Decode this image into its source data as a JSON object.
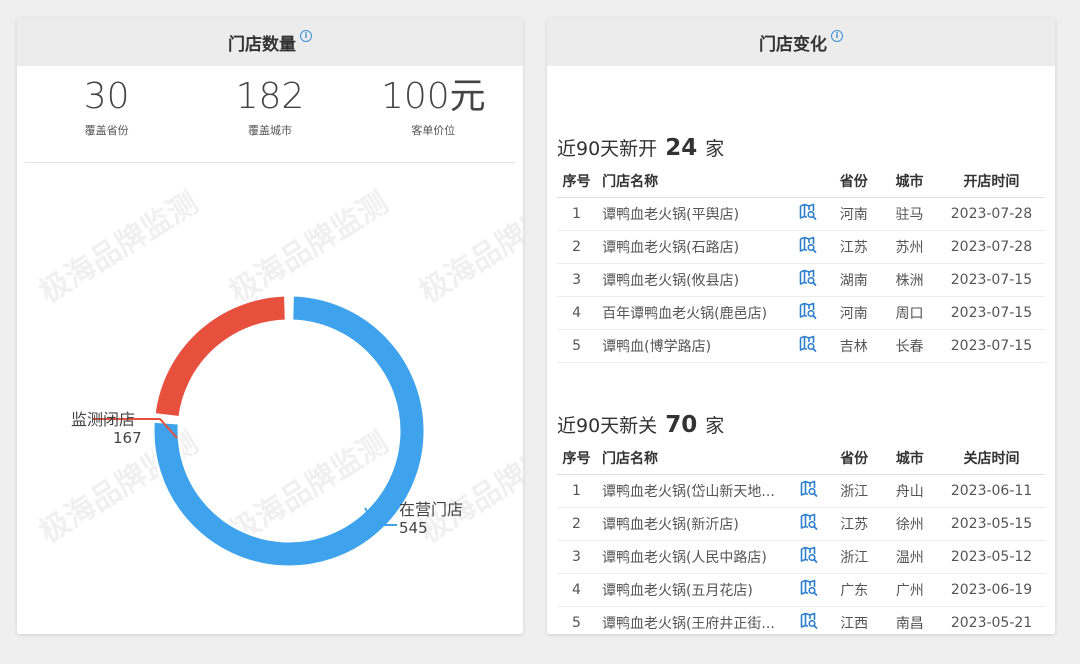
{
  "left_card": {
    "title": "门店数量",
    "info_glyph": "i",
    "stats": [
      {
        "value": "30",
        "label": "覆盖省份"
      },
      {
        "value": "182",
        "label": "覆盖城市"
      },
      {
        "value": "100元",
        "label": "客单价位"
      }
    ],
    "watermark": "极海品牌监测"
  },
  "chart_data": {
    "type": "pie",
    "variant": "donut",
    "slices": [
      {
        "label": "在营门店",
        "value": 545,
        "color": "#3ea3ec"
      },
      {
        "label": "监测闭店",
        "value": 167,
        "color": "#e8503e"
      }
    ],
    "labels": {
      "open_label": "在营门店",
      "open_value": "545",
      "closed_label": "监测闭店",
      "closed_value": "167"
    }
  },
  "right_card": {
    "title": "门店变化",
    "info_glyph": "i",
    "new_section": {
      "prefix": "近90天新开",
      "count": "24",
      "suffix": "家",
      "headers": [
        "序号",
        "门店名称",
        "",
        "省份",
        "城市",
        "开店时间"
      ],
      "rows": [
        {
          "idx": "1",
          "name": "谭鸭血老火锅(平舆店)",
          "province": "河南",
          "city": "驻马",
          "date": "2023-07-28"
        },
        {
          "idx": "2",
          "name": "谭鸭血老火锅(石路店)",
          "province": "江苏",
          "city": "苏州",
          "date": "2023-07-28"
        },
        {
          "idx": "3",
          "name": "谭鸭血老火锅(攸县店)",
          "province": "湖南",
          "city": "株洲",
          "date": "2023-07-15"
        },
        {
          "idx": "4",
          "name": "百年谭鸭血老火锅(鹿邑店)",
          "province": "河南",
          "city": "周口",
          "date": "2023-07-15"
        },
        {
          "idx": "5",
          "name": "谭鸭血(博学路店)",
          "province": "吉林",
          "city": "长春",
          "date": "2023-07-15"
        }
      ]
    },
    "closed_section": {
      "prefix": "近90天新关",
      "count": "70",
      "suffix": "家",
      "headers": [
        "序号",
        "门店名称",
        "",
        "省份",
        "城市",
        "关店时间"
      ],
      "rows": [
        {
          "idx": "1",
          "name": "谭鸭血老火锅(岱山新天地...",
          "province": "浙江",
          "city": "舟山",
          "date": "2023-06-11"
        },
        {
          "idx": "2",
          "name": "谭鸭血老火锅(新沂店)",
          "province": "江苏",
          "city": "徐州",
          "date": "2023-05-15"
        },
        {
          "idx": "3",
          "name": "谭鸭血老火锅(人民中路店)",
          "province": "浙江",
          "city": "温州",
          "date": "2023-05-12"
        },
        {
          "idx": "4",
          "name": "谭鸭血老火锅(五月花店)",
          "province": "广东",
          "city": "广州",
          "date": "2023-06-19"
        },
        {
          "idx": "5",
          "name": "谭鸭血老火锅(王府井正街...",
          "province": "江西",
          "city": "南昌",
          "date": "2023-05-21"
        }
      ]
    },
    "map_icon_color": "#2f7fcf"
  }
}
